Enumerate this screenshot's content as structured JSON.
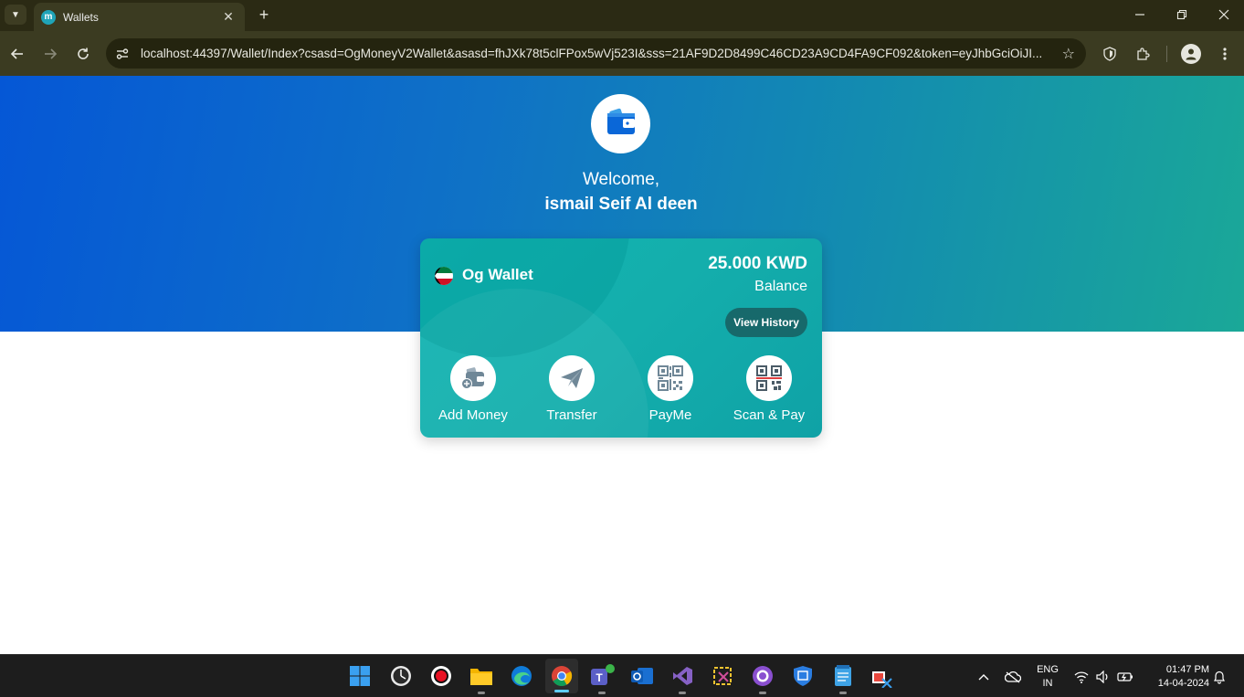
{
  "browser": {
    "tab_title": "Wallets",
    "tab_close": "✕",
    "new_tab": "+",
    "url": "localhost:44397/Wallet/Index?csasd=OgMoneyV2Wallet&asasd=fhJXk78t5clFPox5wVj523I&sss=21AF9D2D8499C46CD23A9CD4FA9CF092&token=eyJhbGciOiJI..."
  },
  "page": {
    "welcome": "Welcome,",
    "user_name": "ismail Seif Al deen"
  },
  "wallet": {
    "name": "Og Wallet",
    "balance": "25.000 KWD",
    "balance_label": "Balance",
    "view_history": "View History"
  },
  "actions": [
    {
      "label": "Add Money"
    },
    {
      "label": "Transfer"
    },
    {
      "label": "PayMe"
    },
    {
      "label": "Scan & Pay"
    }
  ],
  "taskbar": {
    "language": "ENG",
    "region": "IN",
    "time": "01:47 PM",
    "date": "14-04-2024"
  },
  "colors": {
    "hero_start": "#0557d6",
    "hero_end": "#1aa898",
    "card": "#11b5b2",
    "history_button": "#17696b"
  }
}
